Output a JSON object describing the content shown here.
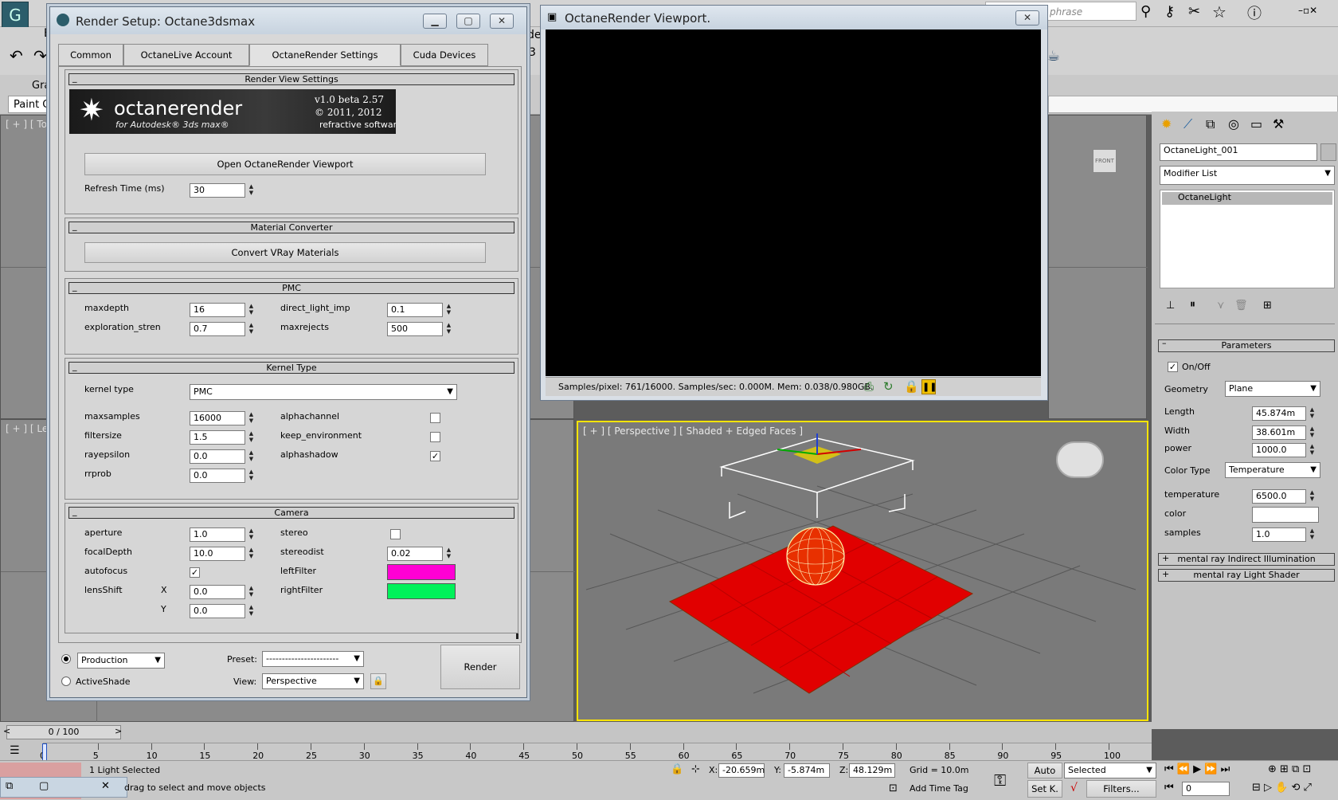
{
  "app": {
    "search_placeholder": "phrase",
    "menu_partial_b": "E",
    "tab_partial_gra": "Gra",
    "tab_partial_paint": "Paint C",
    "top_vp_label": "[ + ] [ Top",
    "left_vp_label": "[ + ] [ Left",
    "partial_3": "3",
    "partial_de": "de"
  },
  "render_setup": {
    "title": "Render Setup: Octane3dsmax",
    "tabs": [
      "Common",
      "OctaneLive Account",
      "OctaneRender Settings",
      "Cuda Devices"
    ],
    "render_view_settings": {
      "header": "Render View Settings",
      "logo_brand": "octanerender",
      "logo_sub": "for Autodesk® 3ds max®",
      "logo_version": "v1.0 beta 2.57",
      "logo_copyright": "© 2011, 2012",
      "logo_company": "refractive software",
      "open_viewport_button": "Open OctaneRender Viewport",
      "refresh_label": "Refresh Time (ms)",
      "refresh_value": "30"
    },
    "material_converter": {
      "header": "Material Converter",
      "convert_button": "Convert VRay Materials"
    },
    "pmc": {
      "header": "PMC",
      "maxdepth_label": "maxdepth",
      "maxdepth_value": "16",
      "exploration_label": "exploration_stren",
      "exploration_value": "0.7",
      "direct_light_label": "direct_light_imp",
      "direct_light_value": "0.1",
      "maxrejects_label": "maxrejects",
      "maxrejects_value": "500"
    },
    "kernel": {
      "header": "Kernel Type",
      "kernel_type_label": "kernel type",
      "kernel_type_value": "PMC",
      "maxsamples_label": "maxsamples",
      "maxsamples_value": "16000",
      "filtersize_label": "filtersize",
      "filtersize_value": "1.5",
      "rayepsilon_label": "rayepsilon",
      "rayepsilon_value": "0.0",
      "rrprob_label": "rrprob",
      "rrprob_value": "0.0",
      "alphachannel_label": "alphachannel",
      "keep_env_label": "keep_environment",
      "alphashadow_label": "alphashadow"
    },
    "camera": {
      "header": "Camera",
      "aperture_label": "aperture",
      "aperture_value": "1.0",
      "focaldepth_label": "focalDepth",
      "focaldepth_value": "10.0",
      "autofocus_label": "autofocus",
      "lensshift_label": "lensShift",
      "x_label": "X",
      "x_value": "0.0",
      "y_label": "Y",
      "y_value": "0.0",
      "stereo_label": "stereo",
      "stereodist_label": "stereodist",
      "stereodist_value": "0.02",
      "leftfilter_label": "leftFilter",
      "leftfilter_color": "#ff00d4",
      "rightfilter_label": "rightFilter",
      "rightfilter_color": "#00f25a"
    },
    "footer": {
      "production_label": "Production",
      "activeshade_label": "ActiveShade",
      "preset_label": "Preset:",
      "preset_value": "-----------------------",
      "view_label": "View:",
      "view_value": "Perspective",
      "render_button": "Render"
    }
  },
  "octane_viewport": {
    "title": "OctaneRender Viewport.",
    "status": "Samples/pixel: 761/16000. Samples/sec: 0.000M. Mem: 0.038/0.980GB."
  },
  "perspective_viewport": {
    "label": "[ + ] [ Perspective ] [ Shaded + Edged Faces ]",
    "front_label": "FRONT"
  },
  "command_panel": {
    "object_name": "OctaneLight_001",
    "modifier_list": "Modifier List",
    "stack_item": "OctaneLight",
    "parameters_header": "Parameters",
    "onoff_label": "On/Off",
    "geometry_label": "Geometry",
    "geometry_value": "Plane",
    "length_label": "Length",
    "length_value": "45.874m",
    "width_label": "Width",
    "width_value": "38.601m",
    "power_label": "power",
    "power_value": "1000.0",
    "color_type_label": "Color Type",
    "color_type_value": "Temperature",
    "temperature_label": "temperature",
    "temperature_value": "6500.0",
    "color_label": "color",
    "samples_label": "samples",
    "samples_value": "1.0",
    "rollout_indirect": "mental ray Indirect Illumination",
    "rollout_light_shader": "mental ray Light Shader"
  },
  "timeline": {
    "frame_counter": "0 / 100",
    "ticks": [
      "0",
      "5",
      "10",
      "15",
      "20",
      "25",
      "30",
      "35",
      "40",
      "45",
      "50",
      "55",
      "60",
      "65",
      "70",
      "75",
      "80",
      "85",
      "90",
      "95",
      "100"
    ]
  },
  "status_bar": {
    "selection": "1 Light Selected",
    "prompt": "drag to select and move objects",
    "x_label": "X:",
    "x_value": "-20.659m",
    "y_label": "Y:",
    "y_value": "-5.874m",
    "z_label": "Z:",
    "z_value": "48.129m",
    "grid": "Grid = 10.0m",
    "add_time_tag": "Add Time Tag",
    "auto": "Auto",
    "selected": "Selected",
    "set_k": "Set K.",
    "filters": "Filters...",
    "frame_value": "0"
  }
}
